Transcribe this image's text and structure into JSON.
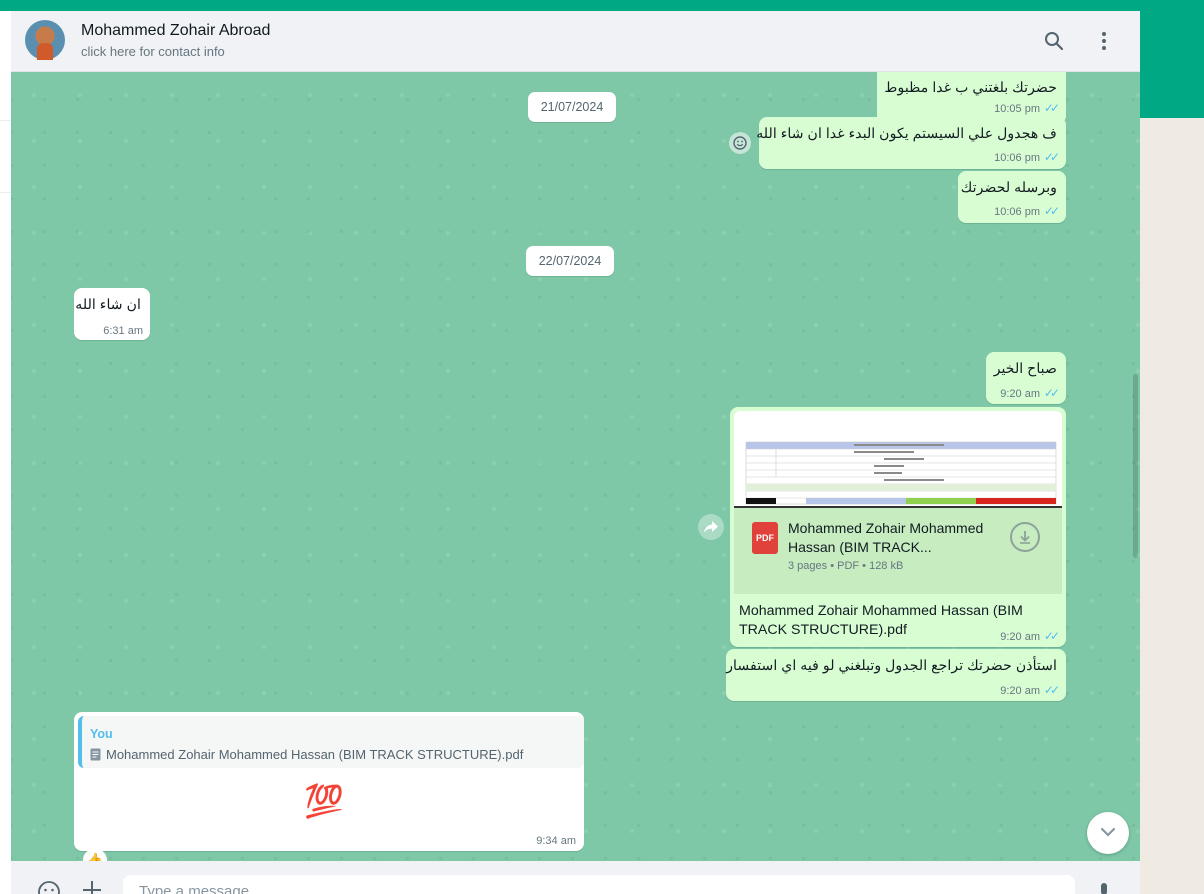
{
  "header": {
    "contact_name": "Mohammed Zohair Abroad",
    "contact_sub": "click here for contact info",
    "icons": [
      "search-icon",
      "menu-icon"
    ]
  },
  "dates": [
    "21/07/2024",
    "22/07/2024"
  ],
  "messages": [
    {
      "text": "حضرتك بلغتني ب غدا مظبوط",
      "time": "10:05 pm",
      "direction": "out"
    },
    {
      "text": "ف هجدول علي السيستم يكون البدء غدا ان شاء الله",
      "time": "10:06 pm",
      "direction": "out"
    },
    {
      "text": "وبرسله لحضرتك",
      "time": "10:06 pm",
      "direction": "out"
    },
    {
      "text": "ان شاء الله",
      "time": "6:31 am",
      "direction": "in"
    },
    {
      "text": "صباح الخير",
      "time": "9:20 am",
      "direction": "out"
    },
    {
      "text": "استأذن حضرتك تراجع الجدول وتبلغني لو فيه اي استفسار",
      "time": "9:20 am",
      "direction": "out"
    }
  ],
  "document": {
    "title_line1": "Mohammed Zohair Mohammed",
    "title_line2": "Hassan (BIM TRACK...",
    "meta": "3 pages • PDF • 128 kB",
    "badge": "PDF",
    "caption_line1": "Mohammed Zohair Mohammed Hassan (BIM",
    "caption_line2": "TRACK STRUCTURE).pdf",
    "time": "9:20 am"
  },
  "reply": {
    "quoted_author": "You",
    "quoted_file": "Mohammed Zohair Mohammed Hassan (BIM TRACK STRUCTURE).pdf",
    "emoji": "💯",
    "time": "9:34 am",
    "reaction": "👍"
  },
  "composer": {
    "placeholder": "Type a message"
  },
  "colors": {
    "accent": "#00a884",
    "outgoing_bubble": "#d9fdd3",
    "incoming_bubble": "#ffffff",
    "wallpaper": "#7ec8a7",
    "read_ticks": "#53bdeb"
  }
}
